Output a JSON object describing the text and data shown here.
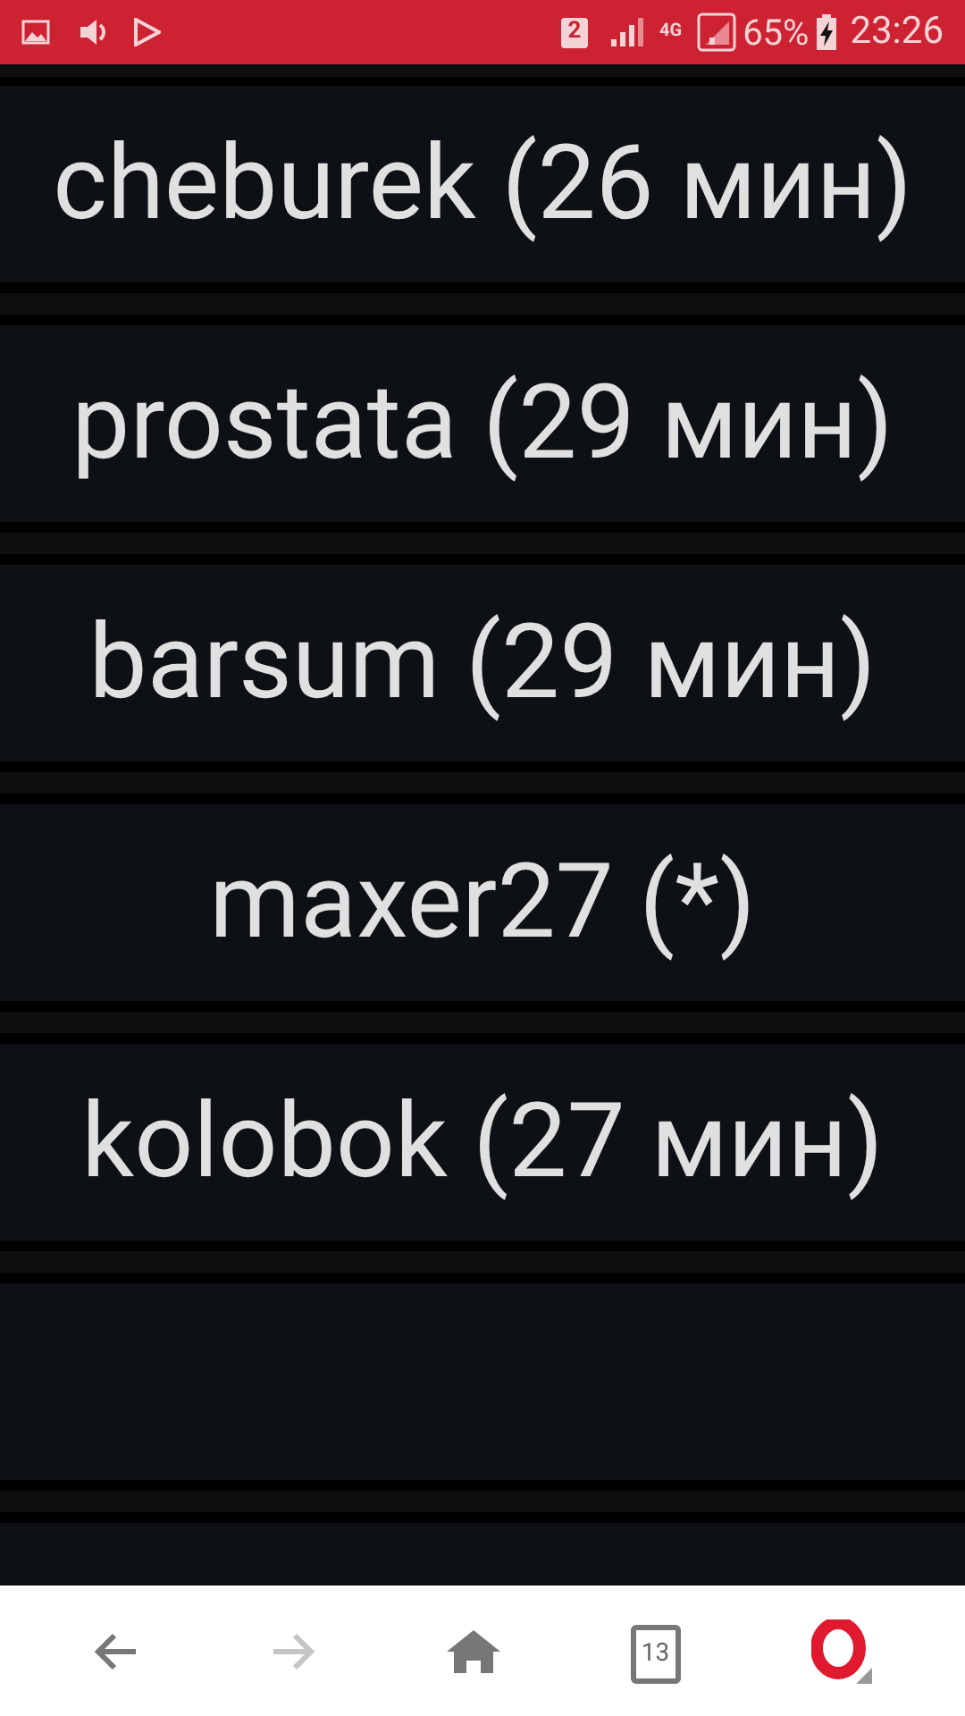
{
  "status_bar": {
    "sim_badge": "2",
    "network": "4G",
    "battery": "65%",
    "time": "23:26"
  },
  "rows": [
    {
      "label": "cheburek (26 мин)"
    },
    {
      "label": "prostata (29 мин)"
    },
    {
      "label": "barsum (29 мин)"
    },
    {
      "label": "maxer27 (*)"
    },
    {
      "label": "kolobok (27 мин)"
    }
  ],
  "bottom_bar": {
    "tab_count": "13"
  }
}
